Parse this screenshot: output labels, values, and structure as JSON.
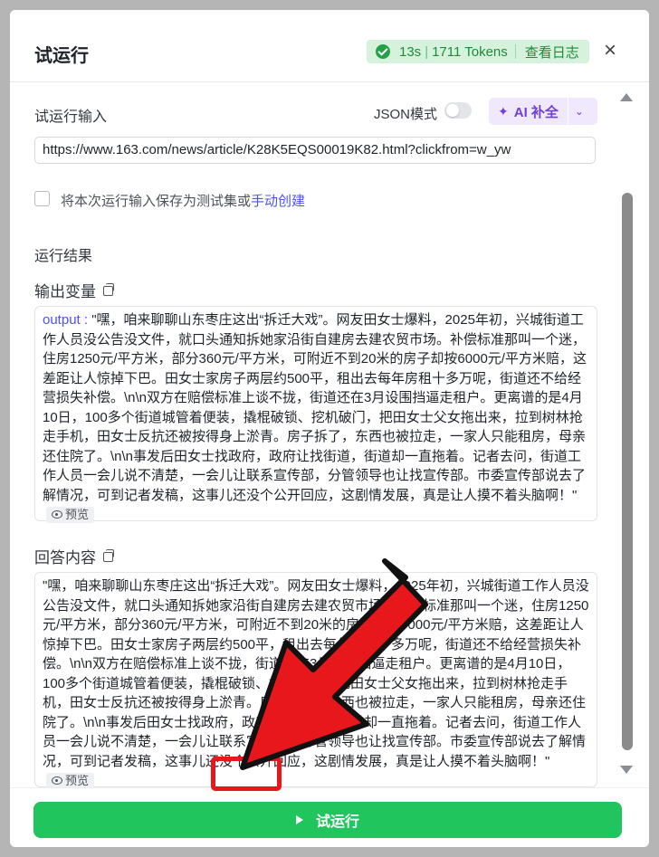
{
  "header": {
    "title": "试运行",
    "duration": "13s",
    "tokens": "1711 Tokens",
    "view_log": "查看日志",
    "close_symbol": "×"
  },
  "input_section": {
    "label": "试运行输入",
    "json_mode_label": "JSON模式",
    "json_mode_on": false,
    "ai_fill_label": "AI 补全",
    "url_value": "https://www.163.com/news/article/K28K5EQS00019K82.html?clickfrom=w_yw",
    "save_checkbox_label": "将本次运行输入保存为测试集或",
    "manual_create_link": "手动创建"
  },
  "results": {
    "section_label": "运行结果",
    "output_label": "输出变量",
    "output_key": "output",
    "output_separator": " : ",
    "output_text": "\"嘿，咱来聊聊山东枣庄这出“拆迁大戏”。网友田女士爆料，2025年初，兴城街道工作人员没公告没文件，就口头通知拆她家沿街自建房去建农贸市场。补偿标准那叫一个迷，住房1250元/平方米，部分360元/平方米，可附近不到20米的房子却按6000元/平方米赔，这差距让人惊掉下巴。田女士家房子两层约500平，租出去每年房租十多万呢，街道还不给经营损失补偿。\\n\\n双方在赔偿标准上谈不拢，街道还在3月设围挡逼走租户。更离谱的是4月10日，100多个街道城管着便装，撬棍破锁、挖机破门，把田女士父女拖出来，拉到树林抢走手机，田女士反抗还被按得身上淤青。房子拆了，东西也被拉走，一家人只能租房，母亲还住院了。\\n\\n事发后田女士找政府，政府让找街道，街道却一直拖着。记者去问，街道工作人员一会儿说不清楚，一会儿让联系宣传部，分管领导也让找宣传部。市委宣传部说去了解情况，可到记者发稿，这事儿还没个公开回应，这剧情发展，真是让人摸不着头脑啊！\"",
    "answer_label": "回答内容",
    "answer_text": "\"嘿，咱来聊聊山东枣庄这出“拆迁大戏”。网友田女士爆料，2025年初，兴城街道工作人员没公告没文件，就口头通知拆她家沿街自建房去建农贸市场。补偿标准那叫一个迷，住房1250元/平方米，部分360元/平方米，可附近不到20米的房子却按6000元/平方米赔，这差距让人惊掉下巴。田女士家房子两层约500平，租出去每年房租十多万呢，街道还不给经营损失补偿。\\n\\n双方在赔偿标准上谈不拢，街道还在3月设围挡逼走租户。更离谱的是4月10日，100多个街道城管着便装，撬棍破锁、挖机破门，把田女士父女拖出来，拉到树林抢走手机，田女士反抗还被按得身上淤青。房子拆了，东西也被拉走，一家人只能租房，母亲还住院了。\\n\\n事发后田女士找政府，政府让找街道，街道却一直拖着。记者去问，街道工作人员一会儿说不清楚，一会儿让联系宣传部，分管领导也让找宣传部。市委宣传部说去了解情况，可到记者发稿，这事儿还没个公开回应，这剧情发展，真是让人摸不着头脑啊！\"",
    "preview_label": "预览"
  },
  "footer": {
    "run_button_label": "试运行"
  },
  "colors": {
    "accent_purple": "#4d53e8",
    "success_green": "#21c55d",
    "highlight_red": "#e8171b"
  }
}
